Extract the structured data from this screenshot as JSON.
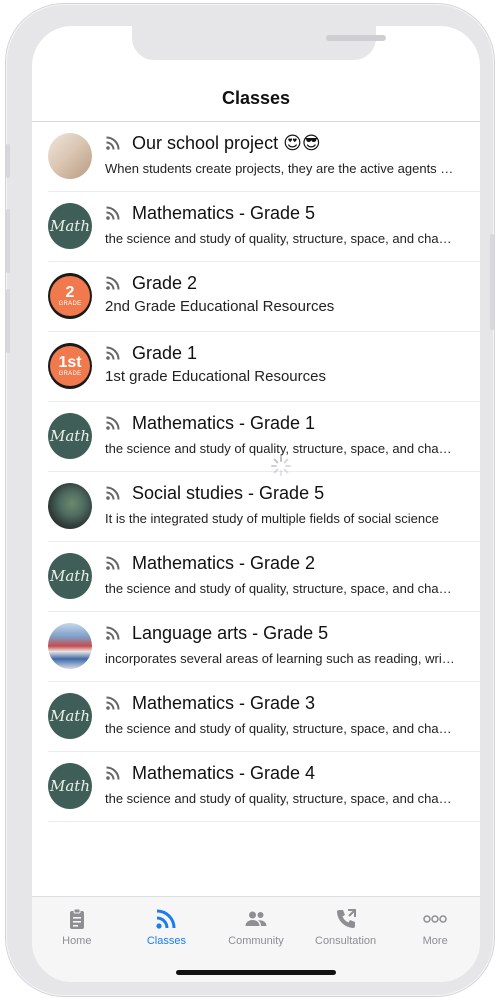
{
  "header": {
    "title": "Classes"
  },
  "classes": [
    {
      "title": "Our school project 😍😎",
      "description": "When students create projects, they are the active agents of their learning",
      "avatar": "student-photo"
    },
    {
      "title": "Mathematics - Grade 5",
      "description": "the science and study of quality, structure, space, and change",
      "avatar": "math-chalkboard",
      "avatar_text": "Math"
    },
    {
      "title": "Grade 2",
      "description": "2nd Grade Educational Resources",
      "avatar": "grade-badge",
      "badge_num": "2",
      "badge_label": "GRADE"
    },
    {
      "title": "Grade 1",
      "description": "1st grade Educational Resources",
      "avatar": "grade-badge",
      "badge_num": "1st",
      "badge_label": "GRADE"
    },
    {
      "title": "Mathematics - Grade 1",
      "description": "the science and study of quality, structure, space, and change",
      "avatar": "math-chalkboard",
      "avatar_text": "Math"
    },
    {
      "title": "Social studies - Grade 5",
      "description": "It is the integrated study of multiple fields of social science",
      "avatar": "globe-photo"
    },
    {
      "title": "Mathematics - Grade 2",
      "description": "the science and study of quality, structure, space, and change",
      "avatar": "math-chalkboard",
      "avatar_text": "Math"
    },
    {
      "title": "Language arts - Grade 5",
      "description": "incorporates several areas of learning such as reading, writing",
      "avatar": "books-photo"
    },
    {
      "title": "Mathematics - Grade 3",
      "description": "the science and study of quality, structure, space, and change",
      "avatar": "math-chalkboard",
      "avatar_text": "Math"
    },
    {
      "title": "Mathematics - Grade 4",
      "description": "the science and study of quality, structure, space, and change",
      "avatar": "math-chalkboard",
      "avatar_text": "Math"
    }
  ],
  "tabbar": {
    "items": [
      {
        "label": "Home",
        "icon": "clipboard-icon",
        "active": false
      },
      {
        "label": "Classes",
        "icon": "rss-icon",
        "active": true
      },
      {
        "label": "Community",
        "icon": "people-icon",
        "active": false
      },
      {
        "label": "Consultation",
        "icon": "phone-icon",
        "active": false
      },
      {
        "label": "More",
        "icon": "more-dots-icon",
        "active": false
      }
    ]
  },
  "colors": {
    "accent": "#1a7cf0",
    "inactive": "#8e8e93",
    "math_board": "#3f5e57",
    "grade_badge": "#f07a4e"
  }
}
